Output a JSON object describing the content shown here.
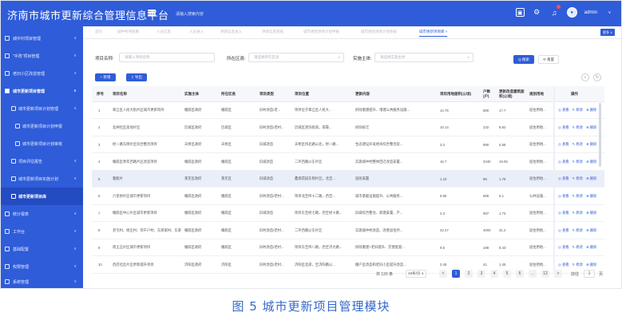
{
  "header": {
    "title": "济南市城市更新综合管理信息平台",
    "note": "请输入搜索内容",
    "user_name": "admin"
  },
  "sidebar": {
    "items": [
      {
        "label": "城中村项目管理",
        "arrow": "∨"
      },
      {
        "label": "“中改”项目管理",
        "arrow": "∨"
      },
      {
        "label": "老旧小区改造管理",
        "arrow": "∨"
      },
      {
        "label": "城市更新项目管理",
        "arrow": "∧"
      },
      {
        "label": "城市更新项目计划管理",
        "arrow": "∧"
      },
      {
        "label": "城市更新项目计划申报",
        "arrow": ""
      },
      {
        "label": "城市更新项目计划审核",
        "arrow": ""
      },
      {
        "label": "项目评估报告",
        "arrow": "∨"
      },
      {
        "label": "城市更新项目实施计划",
        "arrow": "∨"
      },
      {
        "label": "城市更新项目库",
        "arrow": ""
      },
      {
        "label": "统计报表",
        "arrow": "∨"
      },
      {
        "label": "工作台",
        "arrow": "∨"
      },
      {
        "label": "基础配置",
        "arrow": "∨"
      },
      {
        "label": "权限管理",
        "arrow": "∨"
      },
      {
        "label": "系统管理",
        "arrow": "∨"
      }
    ]
  },
  "tabs": [
    "首页",
    "城中村项目库",
    "人员信息",
    "人员录入",
    "项目信息录入",
    "项目信息审核",
    "城市更新项目计划申报",
    "城市更新项目计划审核",
    "城市更新项目库 ×"
  ],
  "tab_more": "更多 ∨",
  "filters": {
    "name_label": "项目名称:",
    "name_placeholder": "请输入项目名称",
    "district_label": "所在区县:",
    "district_placeholder": "请选择所在区县",
    "entity_label": "实施主体:",
    "entity_placeholder": "请选择实施主体",
    "search_label": "Q 搜索",
    "reset_label": "⟲ 重置"
  },
  "toolbar": {
    "add_label": "+ 新增",
    "export_label": "⇩ 导出"
  },
  "table": {
    "headers": [
      "序号",
      "项目名称",
      "实施主体",
      "所在区县",
      "项目类型",
      "项目位置",
      "更新内容",
      "项目用地面积(公顷)",
      "户数(户)",
      "更新改造建筑面积(公顷)",
      "规划用地",
      "操作"
    ],
    "op_labels": [
      "◎ 查看",
      "✎ 修改",
      "⊗ 删除"
    ],
    "rows": [
      [
        "1",
        "章丘区人民大街片区城市更新项目",
        "槐荫区政府",
        "槐荫区",
        "旧村改造/老...",
        "项目位于章丘区人民大...",
        "拆除重建提升、增建公共服务设施...",
        "14.75",
        "580",
        "17.7",
        "居住用地..."
      ],
      [
        "2",
        "北闸社区高地片区",
        "历城区政府",
        "历城区",
        "旧村改造/老村...",
        "历城区港沟街道，南靠...",
        "拆除拆迁",
        "10.14",
        "232",
        "8.82",
        "居住用地..."
      ],
      [
        "3",
        "经一路东侧片区综合整治项目",
        "天桥区政府",
        "天桥区",
        "旧城改造",
        "天桥区纬北路以北，经一路...",
        "生态建设开发地块综合整治及...",
        "3.3",
        "890",
        "5.58",
        "居住用地..."
      ],
      [
        "4",
        "槐荫区青年西路片区改造项目",
        "槐荫区政府",
        "槐荫区",
        "旧城改造",
        "二环西路以东片区",
        "实施城中村整体回迁改造安置...",
        "16.7",
        "3440",
        "19.06",
        "居住用地..."
      ],
      [
        "5",
        "鲁能片",
        "莱芜区政府",
        "莱芜区",
        "旧城改造",
        "鑫源花园东侧片区，北至...",
        "居民安置",
        "1.10",
        "98",
        "1.75",
        "居住用地..."
      ],
      [
        "6",
        "六里桥片区城市更新项目",
        "槐荫区政府",
        "槐荫区",
        "旧村改造/老村...",
        "项目北至纬十二路，西至...",
        "城市基础设施提升、公共服务...",
        "6.55",
        "585",
        "6.1",
        "公共设施..."
      ],
      [
        "7",
        "槐荫区中心片区城市更新项目",
        "槐荫区政府",
        "槐荫区",
        "旧城改造",
        "项目东至经七路，西至经十路...",
        "旧城综合整治、新建安置、产...",
        "2.3",
        "697",
        "1.73",
        "居住用地..."
      ],
      [
        "8",
        "老屯村、杨庄村、何千户村、东梁家村、东梁家村...",
        "槐荫区政府",
        "槐荫区",
        "旧村改造/老村...",
        "二环西路以东片区",
        "实施城中村改造、改善居住环...",
        "32.27",
        "4000",
        "31.2",
        "居住用地..."
      ],
      [
        "9",
        "周王庄片区城市更新项目",
        "槐荫区政府",
        "槐荫区",
        "旧村改造/老村...",
        "项目东至纬八路，西至济大路...",
        "拆除重建+老旧提升、完善配套...",
        "9.5",
        "188",
        "8.43",
        "居住用地..."
      ],
      [
        "10",
        "西店社区片区更新提升项目",
        "济阳区政府",
        "济阳区",
        "旧村改造/老村...",
        "济阳区北部，至济阳路以...",
        "棚户区改造和老旧小区提升改造...",
        "3.45",
        "41",
        "1.45",
        "居住用地..."
      ]
    ]
  },
  "pagination": {
    "total": "共 120 条",
    "size": "10条/页 ∨",
    "prev": "<",
    "pages": [
      "1",
      "2",
      "3",
      "4",
      "5",
      "6",
      "...",
      "12"
    ],
    "next": ">",
    "jump_label": "前往",
    "jump_value": "1",
    "jump_unit": "页"
  },
  "caption": "图 5   城市更新项目管理模块",
  "colors": {
    "primary": "#2f5cd8",
    "sidebar_active": "#234bc2",
    "caption": "#3569c9"
  }
}
